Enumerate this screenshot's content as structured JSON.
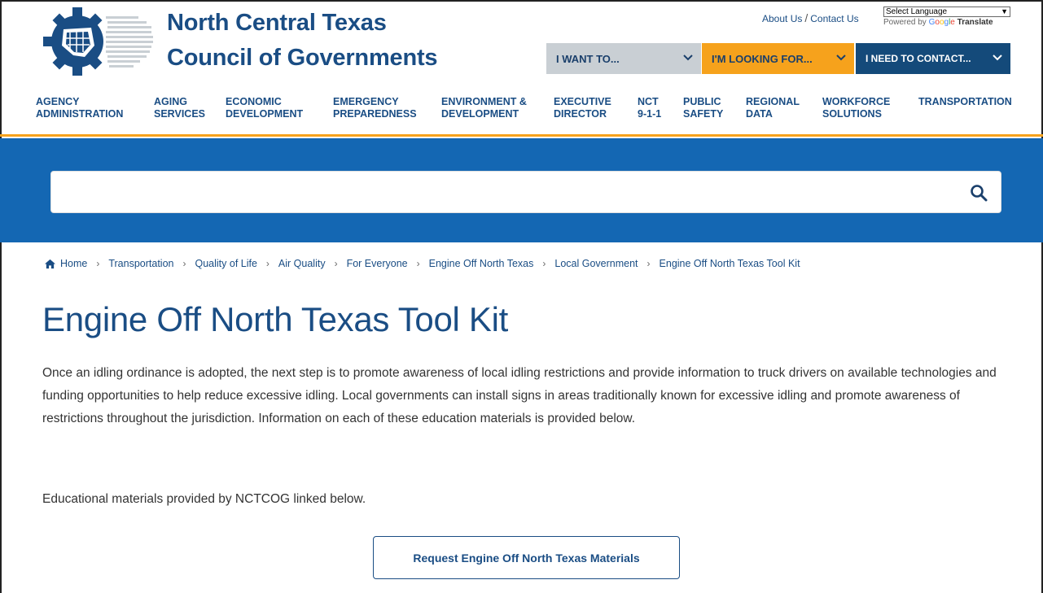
{
  "header": {
    "org_line1": "North Central Texas",
    "org_line2": "Council of Governments",
    "about_label": "About Us",
    "separator": "/",
    "contact_label": "Contact Us",
    "language_select": "Select Language",
    "powered_by": "Powered by",
    "translate": "Translate",
    "google": [
      "G",
      "o",
      "o",
      "g",
      "l",
      "e"
    ],
    "want_label": "I WANT TO...",
    "looking_label": "I'M LOOKING FOR...",
    "contact_dd_label": "I NEED TO CONTACT..."
  },
  "nav": {
    "items": [
      {
        "line1": "AGENCY",
        "line2": "ADMINISTRATION"
      },
      {
        "line1": "AGING",
        "line2": "SERVICES"
      },
      {
        "line1": "ECONOMIC",
        "line2": "DEVELOPMENT"
      },
      {
        "line1": "EMERGENCY",
        "line2": "PREPAREDNESS"
      },
      {
        "line1": "ENVIRONMENT &",
        "line2": "DEVELOPMENT"
      },
      {
        "line1": "EXECUTIVE",
        "line2": "DIRECTOR"
      },
      {
        "line1": "NCT",
        "line2": "9-1-1"
      },
      {
        "line1": "PUBLIC",
        "line2": "SAFETY"
      },
      {
        "line1": "REGIONAL",
        "line2": "DATA"
      },
      {
        "line1": "WORKFORCE",
        "line2": "SOLUTIONS"
      },
      {
        "line1": "TRANSPORTATION",
        "line2": ""
      }
    ]
  },
  "search": {
    "placeholder": "",
    "value": ""
  },
  "breadcrumb": {
    "items": [
      "Home",
      "Transportation",
      "Quality of Life",
      "Air Quality",
      "For Everyone",
      "Engine Off North Texas",
      "Local Government",
      "Engine Off North Texas Tool Kit"
    ]
  },
  "main": {
    "title": "Engine Off North Texas Tool Kit",
    "paragraph": "Once an idling ordinance is adopted, the next step is to promote awareness of local idling restrictions and provide information to truck drivers on available technologies and funding opportunities to help reduce excessive idling.  Local governments can install signs in areas traditionally known for excessive idling and promote awareness of restrictions throughout the jurisdiction.  Information on each of these education materials is provided below.",
    "paragraph2": "Educational materials provided by NCTCOG linked below.",
    "cta_label": "Request Engine Off North Texas Materials"
  },
  "colors": {
    "brand_blue": "#1a4d84",
    "band_blue": "#1467b3",
    "accent_orange": "#f6a21c",
    "gray_dd": "#c9cfd4",
    "navy_dd": "#144a7a"
  }
}
